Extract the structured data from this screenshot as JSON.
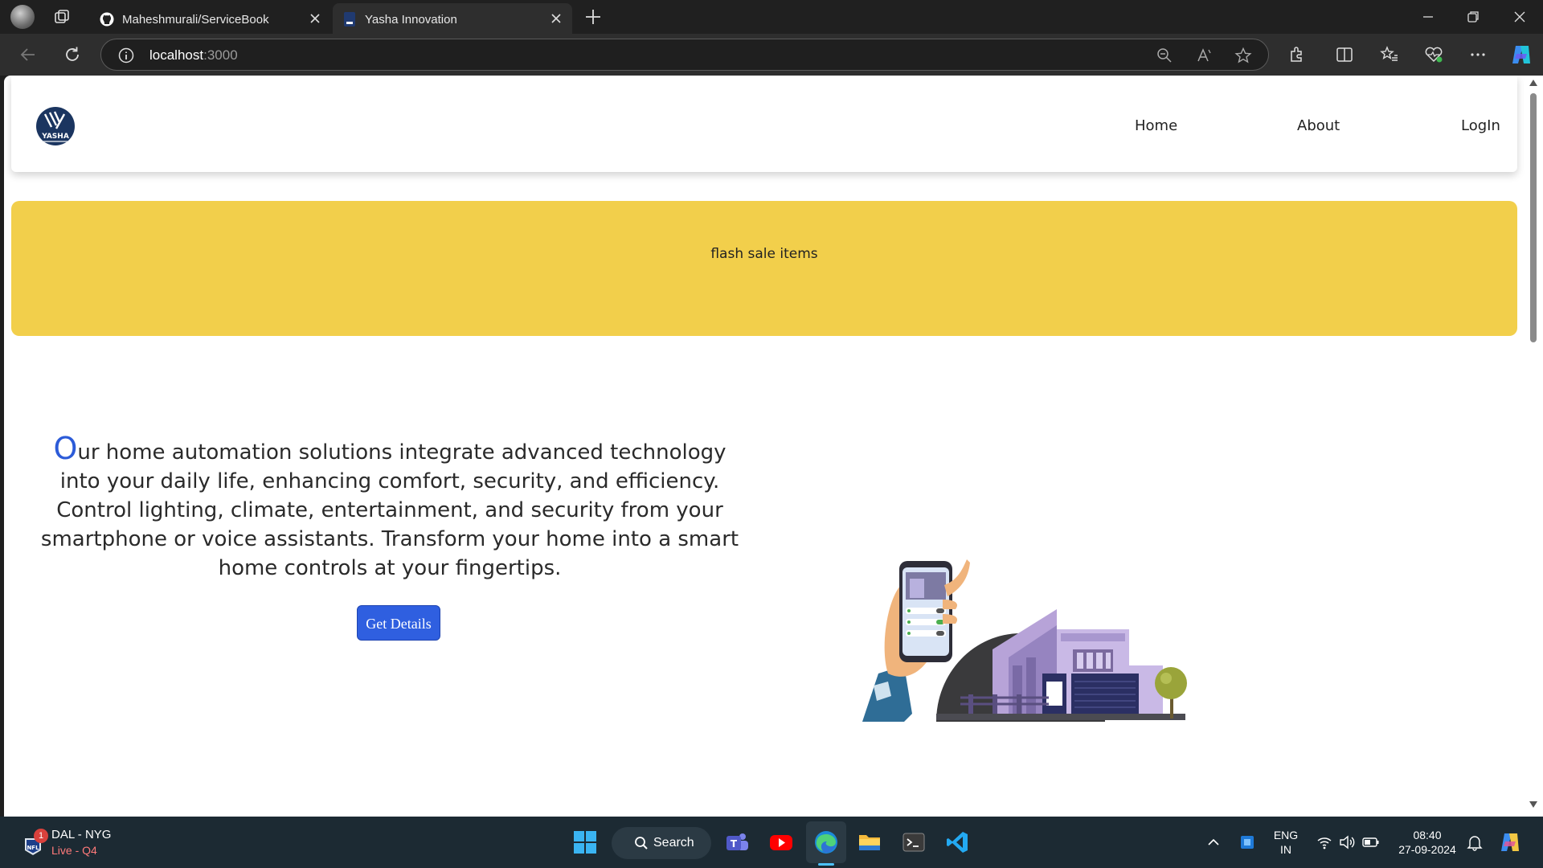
{
  "browser": {
    "tabs": [
      {
        "title": "Maheshmurali/ServiceBook"
      },
      {
        "title": "Yasha Innovation"
      }
    ],
    "address": {
      "host": "localhost",
      "port": ":3000"
    }
  },
  "site": {
    "logo_text": "YASHA",
    "nav": [
      {
        "label": "Home"
      },
      {
        "label": "About"
      },
      {
        "label": "LogIn"
      }
    ],
    "flash_banner": "flash sale items",
    "hero": {
      "drop_cap": "O",
      "text": "ur home automation solutions integrate advanced technology into your daily life, enhancing comfort, security, and efficiency. Control lighting, climate, entertainment, and security from your smartphone or voice assistants. Transform your home into a smart home controls at your fingertips.",
      "button": "Get Details"
    }
  },
  "taskbar": {
    "news": {
      "title": "DAL - NYG",
      "subtitle": "Live - Q4",
      "badge": "1"
    },
    "search_label": "Search",
    "language": {
      "line1": "ENG",
      "line2": "IN"
    },
    "clock": {
      "time": "08:40",
      "date": "27-09-2024"
    }
  },
  "colors": {
    "accent_blue": "#2f5fe0",
    "flash_yellow": "#f2cf4b",
    "taskbar": "#1c2a33"
  }
}
